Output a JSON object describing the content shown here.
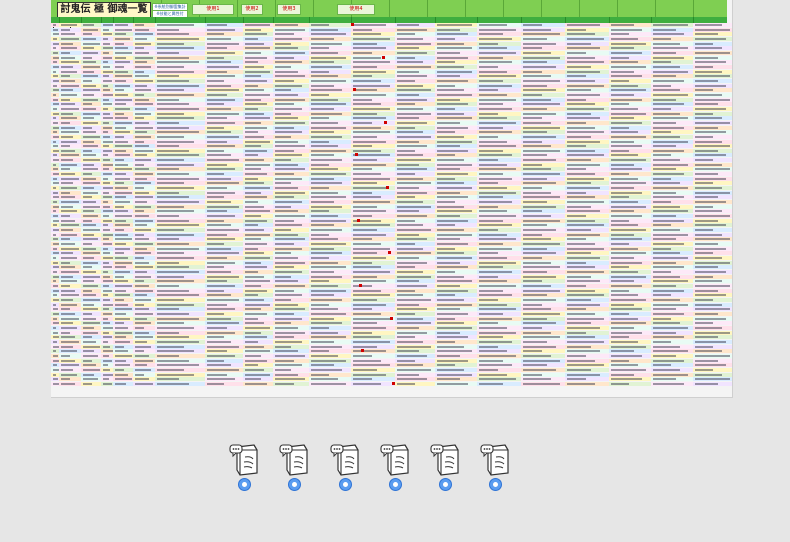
{
  "sheet": {
    "title": "討鬼伝 極 御魂一覧",
    "header_tags": [
      "使用1",
      "使用2",
      "使用3",
      "使用4"
    ],
    "sub_tags": [
      "※系統別御霊集計",
      "※技能と属性付"
    ],
    "colors": {
      "header_band": "#7fcf52",
      "column_header": "#3fae3f",
      "title_bg": "#fff8c8",
      "tag_text": "#c80000",
      "row_palette": [
        "#ffe0ea",
        "#fff6c2",
        "#e1f3d4",
        "#d9ecff",
        "#f1e4ff",
        "#ffe7cc",
        "#e8fbf4",
        "#fde9f8"
      ]
    },
    "row_count": 78
  },
  "tray": {
    "items": [
      {
        "icon": "document-chat-icon",
        "badge": "info-badge-icon"
      },
      {
        "icon": "document-chat-icon",
        "badge": "info-badge-icon"
      },
      {
        "icon": "document-chat-icon",
        "badge": "info-badge-icon"
      },
      {
        "icon": "document-chat-icon",
        "badge": "info-badge-icon"
      },
      {
        "icon": "document-chat-icon",
        "badge": "info-badge-icon"
      },
      {
        "icon": "document-chat-icon",
        "badge": "info-badge-icon"
      }
    ]
  }
}
